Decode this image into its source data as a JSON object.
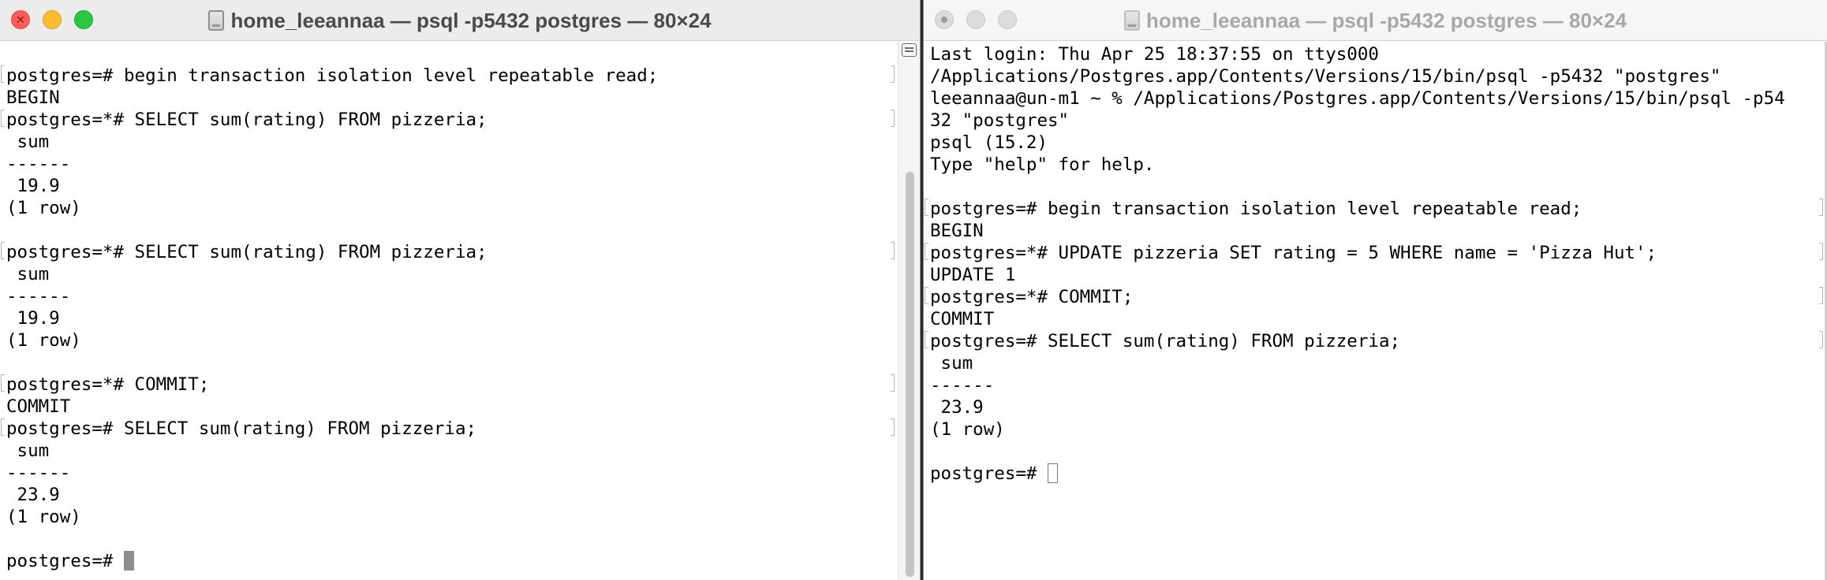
{
  "left_window": {
    "title": "home_leeannaa — psql -p5432 postgres — 80×24",
    "lines": [
      {
        "text": "postgres=# begin transaction isolation level repeatable read;",
        "marked": true
      },
      {
        "text": "BEGIN",
        "marked": false
      },
      {
        "text": "postgres=*# SELECT sum(rating) FROM pizzeria;",
        "marked": true
      },
      {
        "text": " sum",
        "marked": false
      },
      {
        "text": "------",
        "marked": false
      },
      {
        "text": " 19.9",
        "marked": false
      },
      {
        "text": "(1 row)",
        "marked": false
      },
      {
        "text": "",
        "marked": false
      },
      {
        "text": "postgres=*# SELECT sum(rating) FROM pizzeria;",
        "marked": true
      },
      {
        "text": " sum",
        "marked": false
      },
      {
        "text": "------",
        "marked": false
      },
      {
        "text": " 19.9",
        "marked": false
      },
      {
        "text": "(1 row)",
        "marked": false
      },
      {
        "text": "",
        "marked": false
      },
      {
        "text": "postgres=*# COMMIT;",
        "marked": true
      },
      {
        "text": "COMMIT",
        "marked": false
      },
      {
        "text": "postgres=# SELECT sum(rating) FROM pizzeria;",
        "marked": true
      },
      {
        "text": " sum",
        "marked": false
      },
      {
        "text": "------",
        "marked": false
      },
      {
        "text": " 23.9",
        "marked": false
      },
      {
        "text": "(1 row)",
        "marked": false
      },
      {
        "text": "",
        "marked": false
      }
    ],
    "prompt": "postgres=# "
  },
  "right_window": {
    "title": "home_leeannaa — psql -p5432 postgres — 80×24",
    "lines": [
      {
        "text": "Last login: Thu Apr 25 18:37:55 on ttys000",
        "marked": false
      },
      {
        "text": "/Applications/Postgres.app/Contents/Versions/15/bin/psql -p5432 \"postgres\"",
        "marked": false
      },
      {
        "text": "leeannaa@un-m1 ~ % /Applications/Postgres.app/Contents/Versions/15/bin/psql -p54",
        "marked": false
      },
      {
        "text": "32 \"postgres\"",
        "marked": false
      },
      {
        "text": "psql (15.2)",
        "marked": false
      },
      {
        "text": "Type \"help\" for help.",
        "marked": false
      },
      {
        "text": "",
        "marked": false
      },
      {
        "text": "postgres=# begin transaction isolation level repeatable read;",
        "marked": true
      },
      {
        "text": "BEGIN",
        "marked": false
      },
      {
        "text": "postgres=*# UPDATE pizzeria SET rating = 5 WHERE name = 'Pizza Hut';",
        "marked": true
      },
      {
        "text": "UPDATE 1",
        "marked": false
      },
      {
        "text": "postgres=*# COMMIT;",
        "marked": true
      },
      {
        "text": "COMMIT",
        "marked": false
      },
      {
        "text": "postgres=# SELECT sum(rating) FROM pizzeria;",
        "marked": true
      },
      {
        "text": " sum",
        "marked": false
      },
      {
        "text": "------",
        "marked": false
      },
      {
        "text": " 23.9",
        "marked": false
      },
      {
        "text": "(1 row)",
        "marked": false
      },
      {
        "text": "",
        "marked": false
      }
    ],
    "prompt": "postgres=# "
  }
}
